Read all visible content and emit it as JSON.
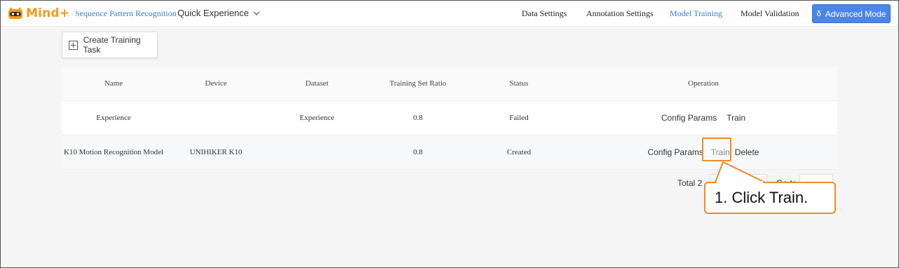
{
  "app": {
    "logo_text": "Mind+",
    "project_name": "Sequence Pattern Recognition",
    "mode_select": "Quick Experience"
  },
  "nav": {
    "items": [
      {
        "label": "Data Settings"
      },
      {
        "label": "Annotation Settings"
      },
      {
        "label": "Model Training"
      },
      {
        "label": "Model Validation"
      }
    ],
    "advanced_label": "Advanced Mode"
  },
  "toolbar": {
    "create_label": "Create Training Task"
  },
  "table": {
    "columns": [
      "Name",
      "Device",
      "Dataset",
      "Training Set Ratio",
      "Status",
      "Operation"
    ],
    "rows": [
      {
        "name": "Experience",
        "device": "",
        "dataset": "Experience",
        "ratio": "0.8",
        "status": "Failed",
        "ops": [
          "Config Params",
          "Train"
        ]
      },
      {
        "name": "K10 Motion Recognition Model",
        "device": "UNIHIKER K10",
        "dataset": "",
        "ratio": "0.8",
        "status": "Created",
        "ops": [
          "Config Params",
          "Train",
          "Delete"
        ]
      }
    ]
  },
  "pagination": {
    "total_label": "Total 2",
    "goto_label": "Go to"
  },
  "callout": {
    "text": "1. Click Train."
  },
  "colors": {
    "accent": "#3a7bd5",
    "highlight": "#f08a24",
    "brand": "#f39a1e"
  }
}
